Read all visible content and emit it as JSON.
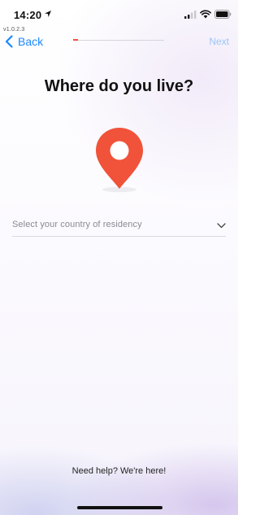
{
  "status_bar": {
    "time": "14:20"
  },
  "app": {
    "version": "v1.0.2.3"
  },
  "nav": {
    "back_label": "Back",
    "next_label": "Next",
    "progress": 0.05
  },
  "main": {
    "title": "Where do you live?",
    "pin_icon": "location-pin-icon",
    "country_select": {
      "placeholder": "Select your country of residency"
    }
  },
  "footer": {
    "help_text": "Need help? We're here!"
  },
  "colors": {
    "accent": "#f0533a",
    "link": "#1b88ff",
    "link_disabled": "#9cc6f5"
  }
}
